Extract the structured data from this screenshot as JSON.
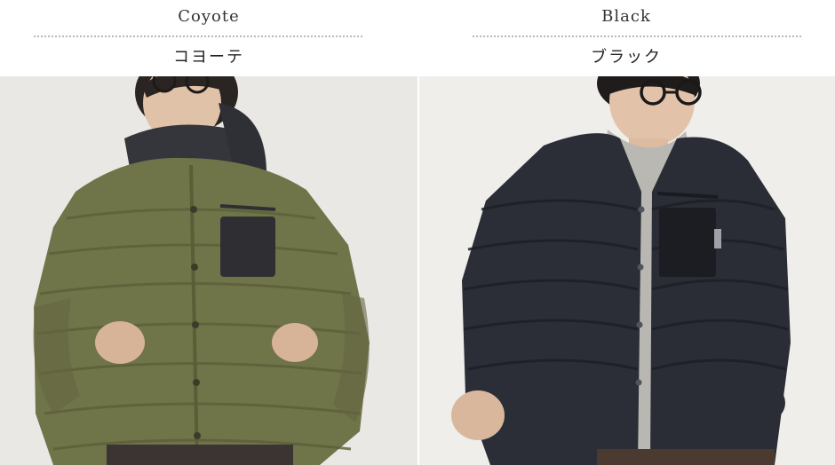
{
  "variants": [
    {
      "name_en": "Coyote",
      "name_jp": "コヨーテ",
      "jacket_color": "#6f7348",
      "image_icon": "person-wearing-olive-down-jacket"
    },
    {
      "name_en": "Black",
      "name_jp": "ブラック",
      "jacket_color": "#2a2d36",
      "image_icon": "person-wearing-black-down-jacket"
    }
  ]
}
